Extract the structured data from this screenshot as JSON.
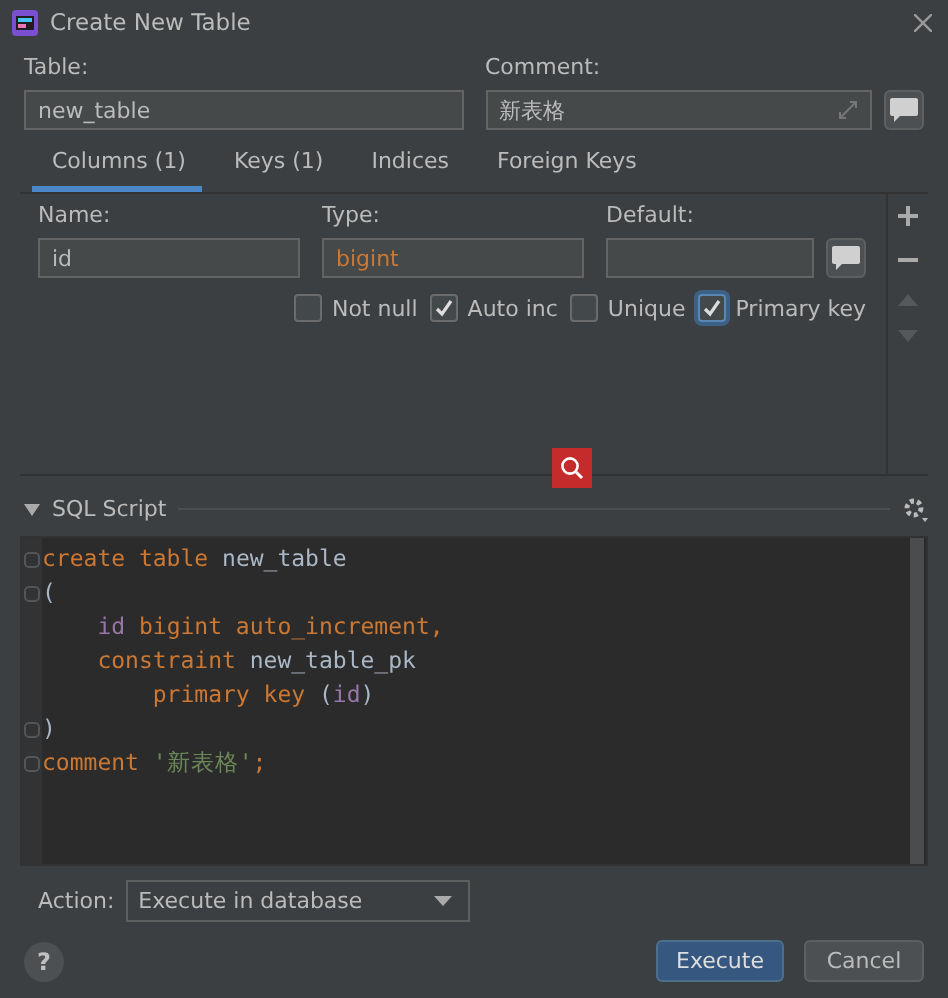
{
  "window": {
    "title": "Create New Table"
  },
  "table_field": {
    "label": "Table:",
    "value": "new_table"
  },
  "comment_field": {
    "label": "Comment:",
    "value": "新表格"
  },
  "tabs": [
    {
      "label": "Columns (1)",
      "selected": true
    },
    {
      "label": "Keys (1)",
      "selected": false
    },
    {
      "label": "Indices",
      "selected": false
    },
    {
      "label": "Foreign Keys",
      "selected": false
    }
  ],
  "column_editor": {
    "name": {
      "label": "Name:",
      "value": "id"
    },
    "type": {
      "label": "Type:",
      "value": "bigint"
    },
    "default": {
      "label": "Default:"
    },
    "options": [
      {
        "label": "Not null",
        "checked": false,
        "focused": false
      },
      {
        "label": "Auto inc",
        "checked": true,
        "focused": false
      },
      {
        "label": "Unique",
        "checked": false,
        "focused": false
      },
      {
        "label": "Primary key",
        "checked": true,
        "focused": true
      }
    ],
    "side_buttons": [
      {
        "kind": "add",
        "disabled": false
      },
      {
        "kind": "remove",
        "disabled": false
      },
      {
        "kind": "up",
        "disabled": true
      },
      {
        "kind": "down",
        "disabled": true
      }
    ]
  },
  "sql_script": {
    "title": "SQL Script",
    "expanded": true,
    "lines": [
      {
        "fold": true,
        "tokens": [
          {
            "kind": "keyword",
            "text": "create table"
          },
          {
            "kind": "plain",
            "text": " new_table"
          }
        ]
      },
      {
        "fold": true,
        "tokens": [
          {
            "kind": "plain",
            "text": "("
          }
        ]
      },
      {
        "fold": false,
        "tokens": [
          {
            "kind": "field",
            "text": "    id"
          },
          {
            "kind": "keyword",
            "text": " bigint auto_increment,"
          }
        ]
      },
      {
        "fold": false,
        "tokens": [
          {
            "kind": "keyword",
            "text": "    constraint"
          },
          {
            "kind": "plain",
            "text": " new_table_pk"
          }
        ]
      },
      {
        "fold": false,
        "tokens": [
          {
            "kind": "keyword",
            "text": "        primary key"
          },
          {
            "kind": "plain",
            "text": " ("
          },
          {
            "kind": "field",
            "text": "id"
          },
          {
            "kind": "plain",
            "text": ")"
          }
        ]
      },
      {
        "fold": true,
        "tokens": [
          {
            "kind": "plain",
            "text": ")"
          }
        ]
      },
      {
        "fold": true,
        "tokens": [
          {
            "kind": "keyword",
            "text": "comment"
          },
          {
            "kind": "string",
            "text": " '新表格'"
          },
          {
            "kind": "keyword",
            "text": ";"
          }
        ]
      }
    ]
  },
  "action": {
    "label": "Action:",
    "value": "Execute in database"
  },
  "help": "?",
  "buttons": [
    {
      "label": "Execute",
      "kind": "primary"
    },
    {
      "label": "Cancel",
      "kind": "secondary"
    }
  ]
}
